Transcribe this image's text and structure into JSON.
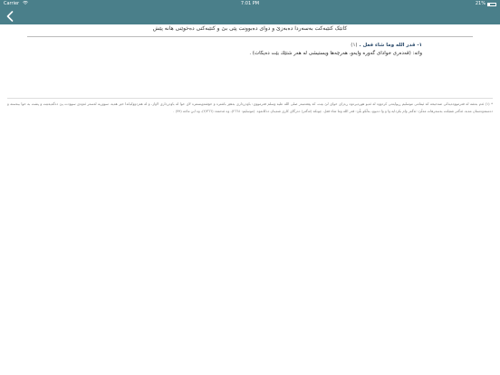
{
  "status_bar": {
    "carrier": "Carrier",
    "time": "7:01 PM",
    "battery": "21%",
    "battery_level": 0.21
  },
  "nav": {
    "back_icon": "chevron-left-icon"
  },
  "header": {
    "text": "کاتێک کتێبەکت بەسەردا دەبەزێ و دوای دەبوونت پێی بێ و کتێبەکتی دەخوێنی هانە پێش"
  },
  "verse": {
    "text": "١- قدر الله وما شاء فعل .",
    "number": "(١)"
  },
  "translation": {
    "text": "واتە: (قەدەری خوادای گەورە وایەو، هەرچەها ویستیشی لە هەر شتێك بێت دەیکات) ."
  },
  "footnote": {
    "text": "* (١) ئەم بەشە لە فەرموودەیەکی صەحیحە کە ئیمامی موسلیم ڕیوایەتی کردووە لە ئەبو هورەیرەوە ڕەزای خوای لێ بێت، کە پێغەمبەر صلى الله عليه وسلم فەرمووی: باوەڕداری بەهێز باشترە و خۆشەویستترە لای خوا لە باوەڕداری لاواز، و لە هەردووکیاندا خێر هەیە، سووربە لەسەر ئەوەی سوودت پێ دەگەیەنێت و پشت بە خوا ببەستە و دەستەوەستان مەبە، ئەگەر شتێکت بەسەرهات مەڵێ: ئەگەر وام بکردایە وا و وا دەبوو، بەڵکو بڵێ: قدر الله وما شاء فعل، چونکە (ئەگەر) دەرگای کاری شەیتان دەکاتەوە. (موسلیم: ٢٦٦٤)، وە ئەحمەد (٢/٣٦٦)، وە ابن ماجە (٧٩) ."
  },
  "colors": {
    "nav_bar": "#4a7f8a",
    "verse_text": "#2a4a6a",
    "background": "#ffffff"
  }
}
